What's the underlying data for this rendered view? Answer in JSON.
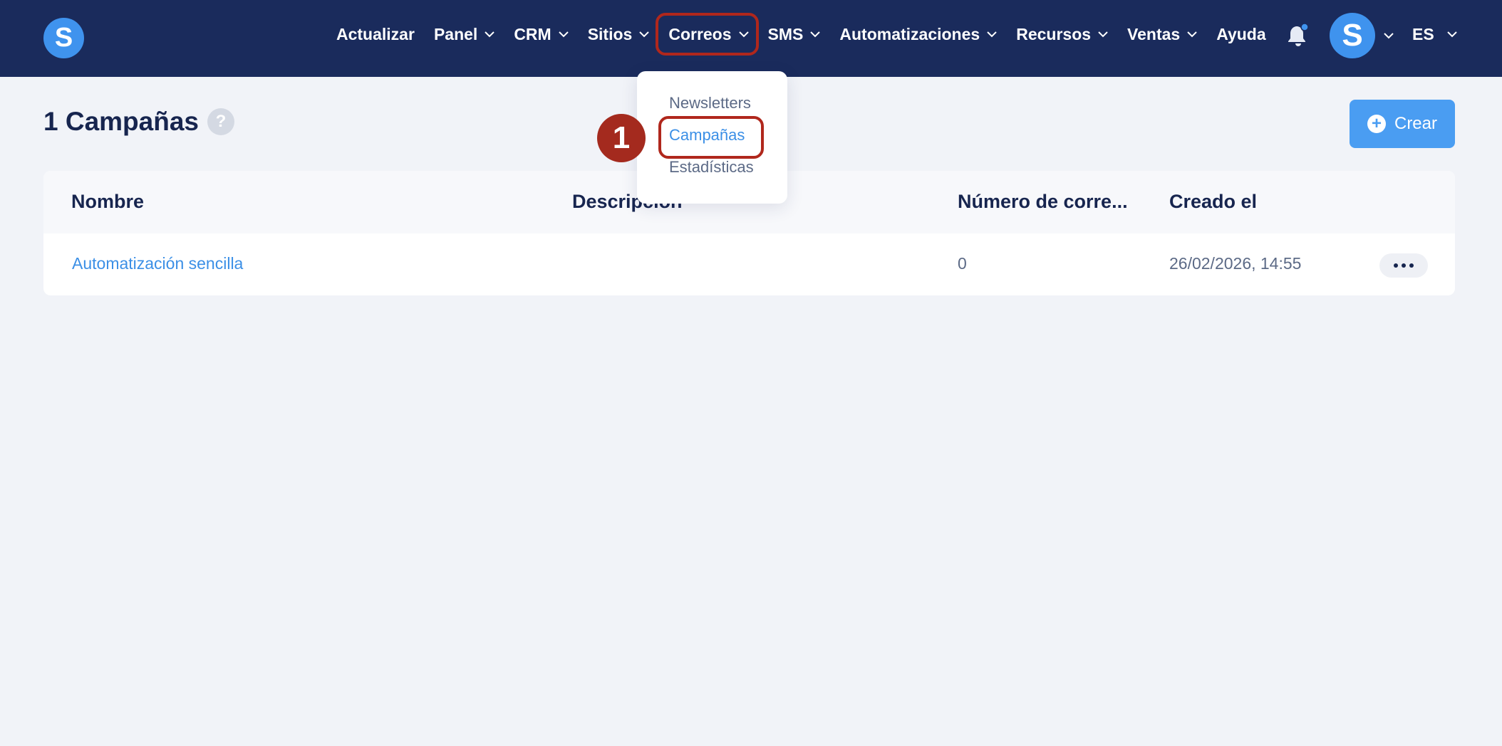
{
  "app": {
    "logo_letter": "S"
  },
  "nav": {
    "items": [
      {
        "label": "Actualizar",
        "has_dropdown": false
      },
      {
        "label": "Panel",
        "has_dropdown": true
      },
      {
        "label": "CRM",
        "has_dropdown": true
      },
      {
        "label": "Sitios",
        "has_dropdown": true
      },
      {
        "label": "Correos",
        "has_dropdown": true,
        "active": true
      },
      {
        "label": "SMS",
        "has_dropdown": true
      },
      {
        "label": "Automatizaciones",
        "has_dropdown": true
      },
      {
        "label": "Recursos",
        "has_dropdown": true
      },
      {
        "label": "Ventas",
        "has_dropdown": true
      },
      {
        "label": "Ayuda",
        "has_dropdown": false
      }
    ],
    "notification_icon": "bell-icon",
    "avatar_letter": "S",
    "language": "ES"
  },
  "dropdown": {
    "items": [
      {
        "label": "Newsletters"
      },
      {
        "label": "Campañas",
        "selected": true
      },
      {
        "label": "Estadísticas"
      }
    ]
  },
  "annotation": {
    "step": "1"
  },
  "page": {
    "title": "1 Campañas",
    "help_icon_label": "?",
    "create_button": "Crear"
  },
  "table": {
    "columns": [
      "Nombre",
      "Descripción",
      "Número de corre...",
      "Creado el"
    ],
    "rows": [
      {
        "name": "Automatización sencilla",
        "description": "",
        "emails": "0",
        "created": "26/02/2026, 14:55"
      }
    ]
  },
  "colors": {
    "topbar": "#1a2b5c",
    "accent": "#3f93ee",
    "highlight": "#b0271c",
    "background": "#f1f3f8"
  }
}
